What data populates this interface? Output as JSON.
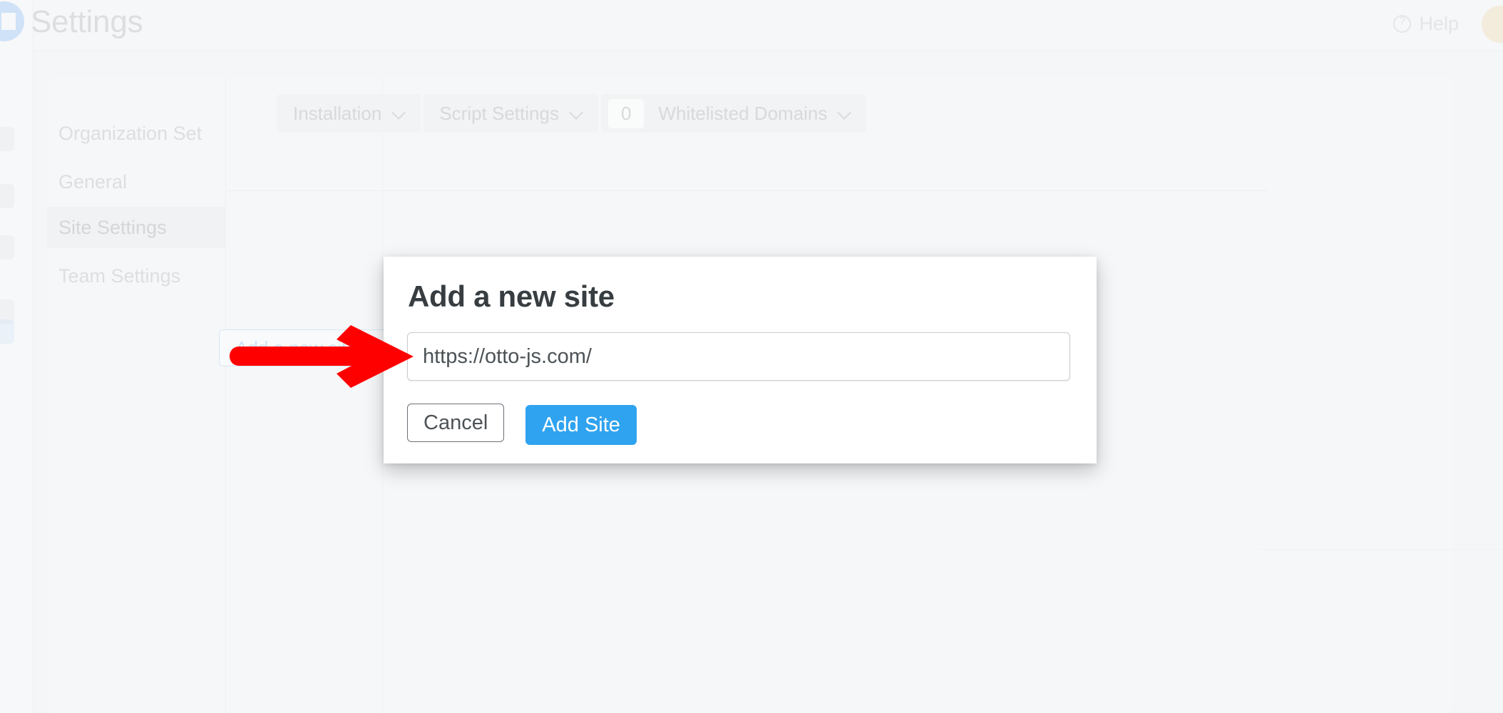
{
  "app": {
    "page_title": "Settings",
    "accent_blue": "#2fa3ef",
    "annotation_color": "#ff0000",
    "modal_title_color": "#373d41"
  },
  "topbar": {
    "help_label": "Help",
    "help_icon": "question-circle-icon",
    "avatar_icon": "user-avatar"
  },
  "rail": {
    "logo_icon": "brand-logo-icon",
    "items": [
      {
        "icon": "dashboard-icon"
      },
      {
        "icon": "list-icon"
      },
      {
        "icon": "shield-icon"
      },
      {
        "icon": "chart-icon"
      },
      {
        "icon": "gear-icon"
      }
    ]
  },
  "sidebar": {
    "items": [
      {
        "label": "Organization Set",
        "active": false
      },
      {
        "label": "General",
        "active": false
      },
      {
        "label": "Site Settings",
        "active": true
      },
      {
        "label": "Team Settings",
        "active": false
      }
    ]
  },
  "tabs": [
    {
      "label": "Installation",
      "chevron": "chevron-down-icon",
      "badge": null
    },
    {
      "label": "Script Settings",
      "chevron": "chevron-down-icon",
      "badge": null
    },
    {
      "label": "Whitelisted Domains",
      "chevron": "chevron-down-icon",
      "badge": "0"
    }
  ],
  "main": {
    "add_site_button_label": "Add a new site"
  },
  "modal": {
    "title": "Add a new site",
    "input": {
      "value": "https://otto-js.com/",
      "placeholder": "https://"
    },
    "cancel_label": "Cancel",
    "submit_label": "Add Site"
  },
  "annotation": {
    "type": "red-arrow",
    "points_to": "site-url-input",
    "direction": "right"
  }
}
